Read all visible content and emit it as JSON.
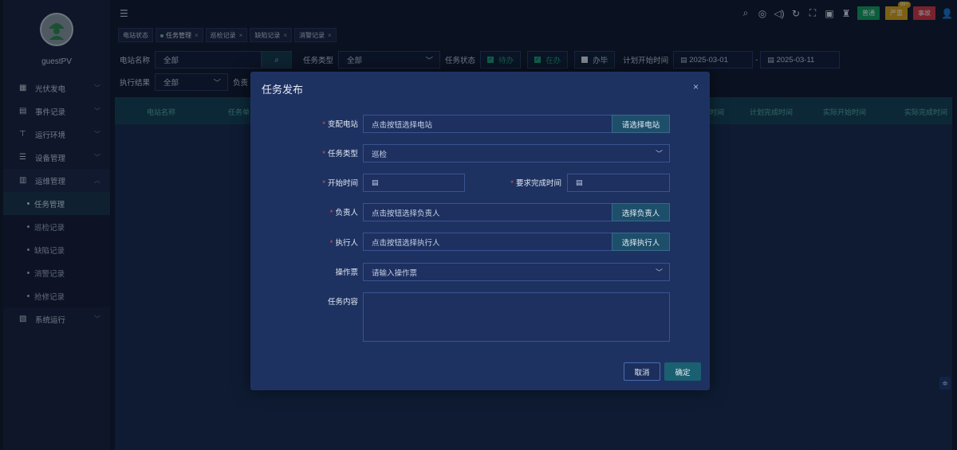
{
  "user": {
    "name": "guestPV"
  },
  "sidebar": {
    "items": [
      {
        "label": "光伏发电",
        "icon": "grid-icon"
      },
      {
        "label": "事件记录",
        "icon": "document-icon"
      },
      {
        "label": "运行环境",
        "icon": "antenna-icon"
      },
      {
        "label": "设备管理",
        "icon": "list-icon"
      },
      {
        "label": "运维管理",
        "icon": "maintenance-icon"
      },
      {
        "label": "系统运行",
        "icon": "system-icon"
      }
    ],
    "subitems": [
      {
        "label": "任务管理"
      },
      {
        "label": "巡检记录"
      },
      {
        "label": "缺陷记录"
      },
      {
        "label": "消警记录"
      },
      {
        "label": "抢修记录"
      }
    ]
  },
  "topbar": {
    "badges": {
      "normal": "普通",
      "serious": "严重",
      "serious_count": "99+",
      "accident": "事故"
    }
  },
  "tabs": [
    {
      "label": "电站状态"
    },
    {
      "label": "任务管理"
    },
    {
      "label": "巡检记录"
    },
    {
      "label": "缺陷记录"
    },
    {
      "label": "消警记录"
    }
  ],
  "filters": {
    "station_label": "电站名称",
    "station_value": "全部",
    "task_type_label": "任务类型",
    "task_type_value": "全部",
    "task_status_label": "任务状态",
    "status_pending": "待办",
    "status_doing": "在办",
    "status_done": "办毕",
    "plan_start_label": "计划开始时间",
    "date_from": "2025-03-01",
    "date_sep": "-",
    "date_to": "2025-03-11",
    "exec_result_label": "执行结果",
    "exec_result_value": "全部",
    "owner_label": "负责"
  },
  "table": {
    "headers": [
      "电站名称",
      "任务单",
      "时间",
      "计划完成时间",
      "实际开始时间",
      "实际完成时间"
    ]
  },
  "modal": {
    "title": "任务发布",
    "substation_label": "变配电站",
    "substation_placeholder": "点击按钮选择电站",
    "substation_button": "请选择电站",
    "task_type_label": "任务类型",
    "task_type_value": "巡检",
    "start_label": "开始时间",
    "deadline_label": "要求完成时间",
    "owner_label": "负责人",
    "owner_placeholder": "点击按钮选择负责人",
    "owner_button": "选择负责人",
    "executor_label": "执行人",
    "executor_placeholder": "点击按钮选择执行人",
    "executor_button": "选择执行人",
    "ticket_label": "操作票",
    "ticket_placeholder": "请输入操作票",
    "content_label": "任务内容",
    "cancel": "取消",
    "confirm": "确定",
    "required_mark": "*"
  },
  "colors": {
    "accent_teal": "#1ea17a",
    "required": "#f0505a",
    "modal_bg": "#1e3261"
  }
}
